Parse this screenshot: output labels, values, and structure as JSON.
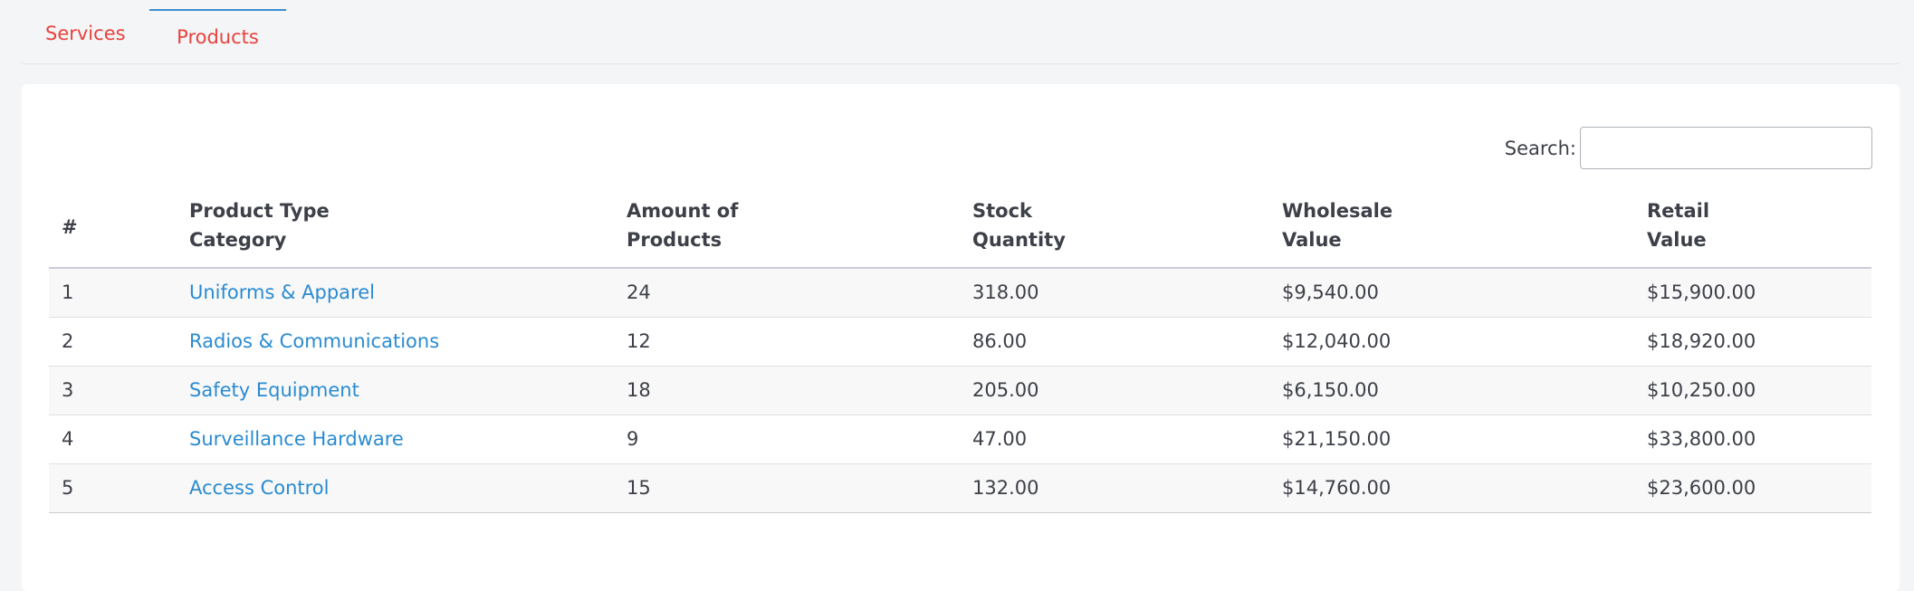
{
  "tabs": [
    {
      "label": "Services",
      "active": false
    },
    {
      "label": "Products",
      "active": true
    }
  ],
  "search": {
    "label": "Search:",
    "value": "",
    "placeholder": ""
  },
  "table": {
    "headers": {
      "num": "#",
      "category_line1": "Product Type",
      "category_line2": "Category",
      "amount_line1": "Amount of",
      "amount_line2": "Products",
      "stock_line1": "Stock",
      "stock_line2": "Quantity",
      "wholesale_line1": "Wholesale",
      "wholesale_line2": "Value",
      "retail_line1": "Retail",
      "retail_line2": "Value"
    },
    "rows": [
      {
        "num": "1",
        "category": "Uniforms & Apparel",
        "amount": "24",
        "stock": "318.00",
        "wholesale": "$9,540.00",
        "retail": "$15,900.00"
      },
      {
        "num": "2",
        "category": "Radios & Communications",
        "amount": "12",
        "stock": "86.00",
        "wholesale": "$12,040.00",
        "retail": "$18,920.00"
      },
      {
        "num": "3",
        "category": "Safety Equipment",
        "amount": "18",
        "stock": "205.00",
        "wholesale": "$6,150.00",
        "retail": "$10,250.00"
      },
      {
        "num": "4",
        "category": "Surveillance Hardware",
        "amount": "9",
        "stock": "47.00",
        "wholesale": "$21,150.00",
        "retail": "$33,800.00"
      },
      {
        "num": "5",
        "category": "Access Control",
        "amount": "15",
        "stock": "132.00",
        "wholesale": "$14,760.00",
        "retail": "$23,600.00"
      }
    ]
  },
  "colors": {
    "tab_text": "#e8423c",
    "active_tab_indicator": "#3a8fd0",
    "link": "#2a8bd0",
    "stripe": "#f8f8f8"
  }
}
